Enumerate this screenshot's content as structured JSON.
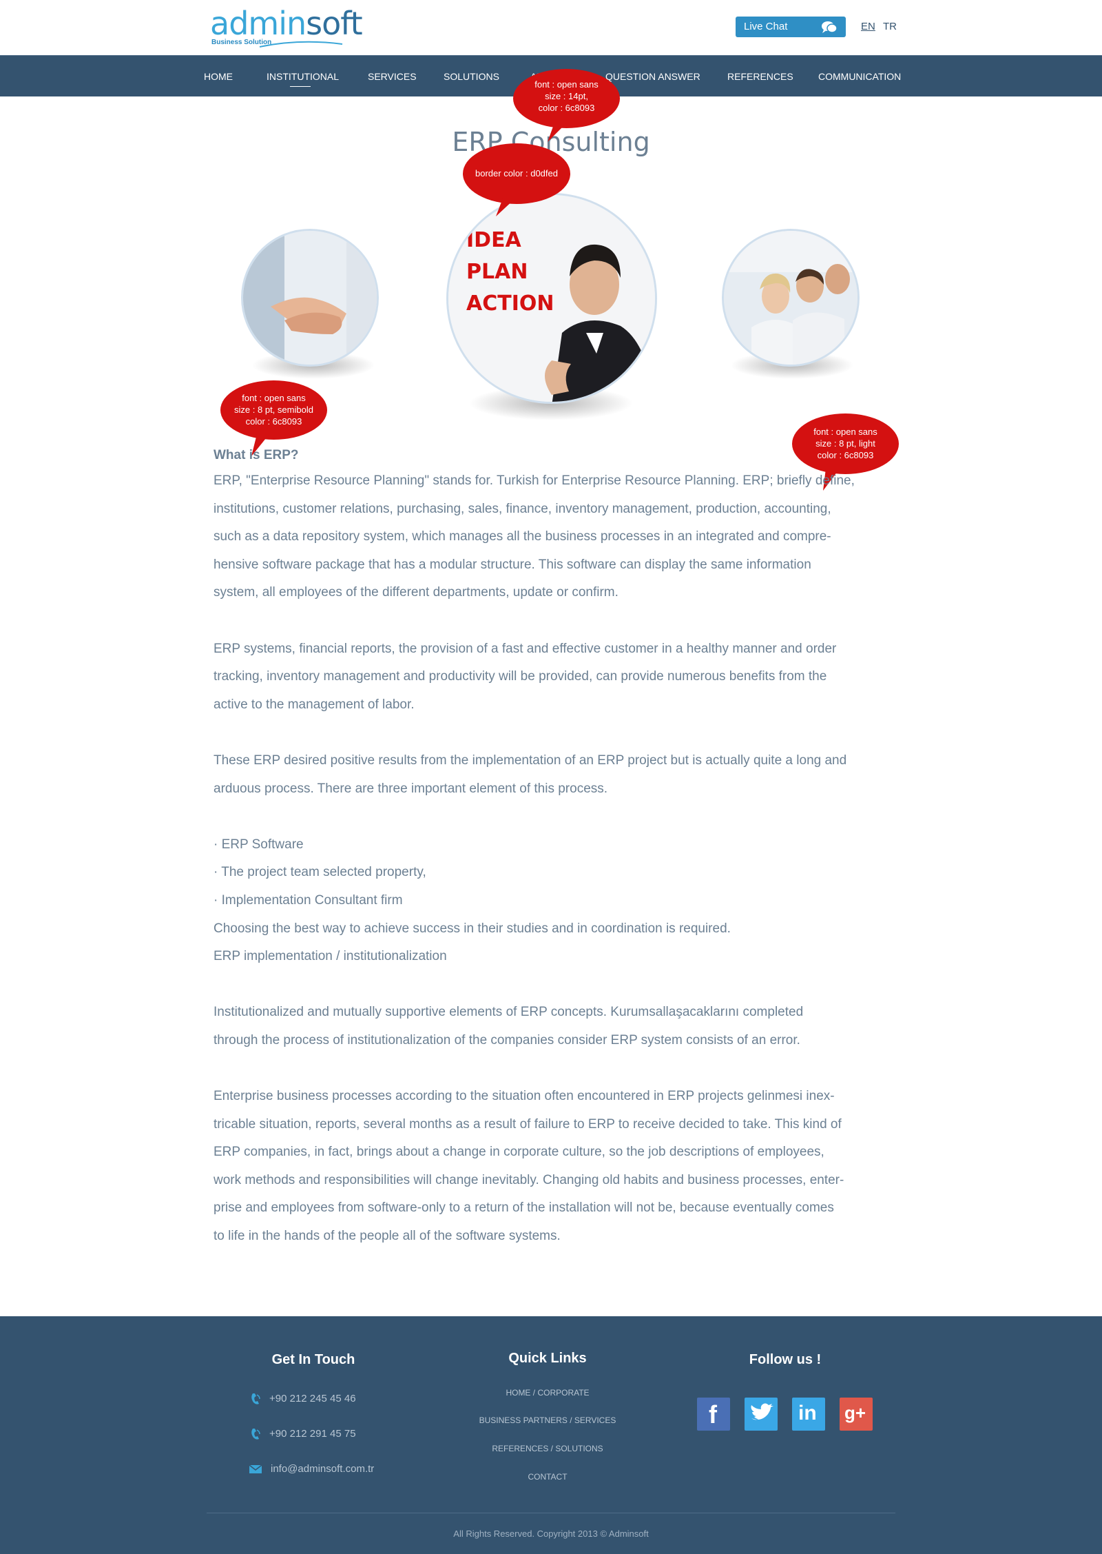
{
  "header": {
    "logo_part1": "admin",
    "logo_part2": "soft",
    "logo_tagline": "Business Solution",
    "live_chat": "Live Chat",
    "lang_en": "EN",
    "lang_tr": "TR"
  },
  "nav": {
    "items": [
      "HOME",
      "INSTITUTIONAL",
      "SERVICES",
      "SOLUTIONS",
      "AB",
      "QUESTION ANSWER",
      "REFERENCES",
      "COMMUNICATION"
    ],
    "active": "INSTITUTIONAL"
  },
  "callouts": {
    "title_font": [
      "font : open sans",
      "size : 14pt,",
      "color : 6c8093"
    ],
    "border": "border color : d0dfed",
    "heading_font": [
      "font : open sans",
      "size : 8 pt, semibold",
      "color : 6c8093"
    ],
    "body_font": [
      "font : open sans",
      "size : 8 pt, light",
      "color : 6c8093"
    ]
  },
  "page": {
    "title": "ERP Consulting",
    "center_image_text": [
      "IDEA",
      "PLAN",
      "ACTION"
    ]
  },
  "content": {
    "heading": "What is ERP?",
    "p1": [
      "ERP, \"Enterprise Resource Planning\" stands for. Turkish for Enterprise Resource Planning. ERP; briefly define,",
      "institutions, customer relations, purchasing, sales, finance, inventory management, production, accounting,",
      "such as a data repository system, which manages all the business processes in an integrated and compre-",
      "hensive software package that has a modular structure. This software can display the same information",
      "system, all employees of the different departments, update or confirm."
    ],
    "p2": [
      "ERP systems, financial reports, the provision of a fast and effective customer in a healthy manner and order",
      "tracking, inventory management and productivity will be provided, can provide numerous benefits from the",
      "active to the management of labor."
    ],
    "p3": [
      "These ERP desired positive results from the implementation of an ERP project but is actually quite a long and",
      "arduous process. There are three important element of this process."
    ],
    "p4": [
      "· ERP Software",
      "· The project team selected property,",
      "· Implementation Consultant firm",
      "Choosing the best way to achieve success in their studies and in coordination is required.",
      "ERP implementation / institutionalization"
    ],
    "p5": [
      "Institutionalized and mutually supportive elements of ERP concepts. Kurumsallaşacaklarını completed",
      "through the process of institutionalization of the companies consider ERP system consists of an error."
    ],
    "p6": [
      "Enterprise business processes according to the situation often encountered in ERP projects gelinmesi inex-",
      "tricable situation, reports, several months as a result of failure to ERP to receive decided to take. This kind of",
      "ERP companies, in fact, brings about a change in corporate culture, so the job descriptions of employees,",
      "work methods and responsibilities will change inevitably. Changing old habits and business processes, enter-",
      "prise and employees from software-only to a return of the installation will not be, because eventually comes",
      "to life in the hands of the people all of the software systems."
    ]
  },
  "footer": {
    "contact_title": "Get In Touch",
    "phone1": "+90 212 245 45 46",
    "phone2": "+90 212 291 45 75",
    "email": "info@adminsoft.com.tr",
    "links_title": "Quick Links",
    "links": [
      "HOME  / CORPORATE",
      "BUSINESS PARTNERS  / SERVICES",
      "REFERENCES  / SOLUTIONS",
      "CONTACT"
    ],
    "follow_title": "Follow us !",
    "social": [
      "f",
      "t",
      "in",
      "g+"
    ],
    "copyright": "All Rights Reserved. Copyright 2013 © Adminsoft"
  },
  "colors": {
    "nav_bg": "#34536f",
    "text": "#6c8093",
    "circle_border": "#d0dfed",
    "callout": "#d41111",
    "live_chat": "#2f8fc5"
  }
}
